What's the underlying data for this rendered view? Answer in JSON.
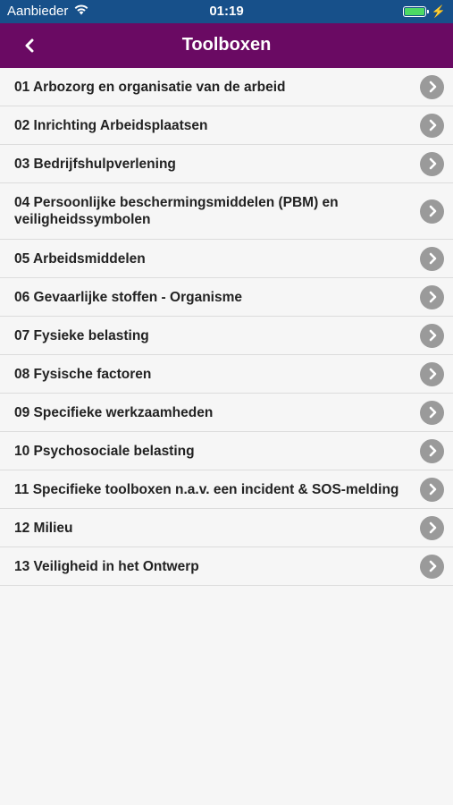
{
  "status_bar": {
    "carrier": "Aanbieder",
    "time": "01:19",
    "battery_level": 1.0,
    "charging_icon": "bolt-icon"
  },
  "nav": {
    "title": "Toolboxen",
    "back_icon": "chevron-left-icon"
  },
  "colors": {
    "status_bar": "#17508a",
    "nav_bar": "#6a0a63",
    "chevron": "#9a9a9a",
    "background": "#f6f6f6"
  },
  "list": {
    "items": [
      {
        "label": "01 Arbozorg en organisatie van de arbeid"
      },
      {
        "label": "02 Inrichting Arbeidsplaatsen"
      },
      {
        "label": "03 Bedrijfshulpverlening"
      },
      {
        "label": "04 Persoonlijke beschermingsmiddelen (PBM) en veiligheidssymbolen"
      },
      {
        "label": "05 Arbeidsmiddelen"
      },
      {
        "label": "06 Gevaarlijke stoffen - Organisme"
      },
      {
        "label": "07 Fysieke belasting"
      },
      {
        "label": "08 Fysische factoren"
      },
      {
        "label": "09 Specifieke werkzaamheden"
      },
      {
        "label": "10 Psychosociale belasting"
      },
      {
        "label": "11 Specifieke toolboxen n.a.v. een incident & SOS-melding"
      },
      {
        "label": "12 Milieu"
      },
      {
        "label": "13 Veiligheid in het Ontwerp"
      }
    ]
  }
}
